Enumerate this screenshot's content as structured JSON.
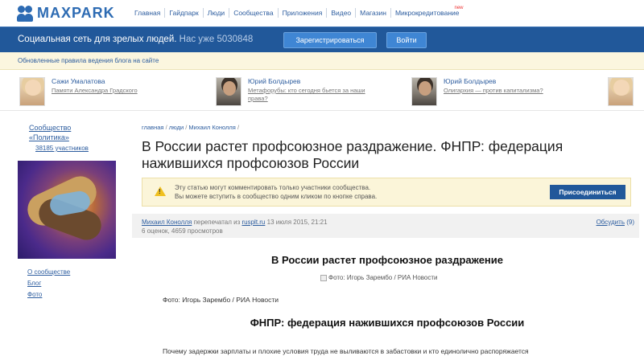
{
  "header": {
    "logo_text": "MAXPARK",
    "menu": [
      "Главная",
      "Гайдпарк",
      "Люди",
      "Сообщества",
      "Приложения",
      "Видео",
      "Магазин",
      "Микрокредитование"
    ],
    "new_badge": "new"
  },
  "bluebar": {
    "tagline": "Социальная сеть для зрелых людей.",
    "count": "Нас уже 5030848",
    "register_label": "Зарегистрироваться",
    "login_label": "Войти"
  },
  "notice_bar": {
    "text": "Обновленные правила ведения блога на сайте"
  },
  "blog_strip": [
    {
      "name": "Сажи Умалатова",
      "post": "Памяти Александра Градского",
      "avatar": "female"
    },
    {
      "name": "Юрий Болдырев",
      "post": "Метафорубы: кто сегодня бьется за наши права?",
      "avatar": "male"
    },
    {
      "name": "Юрий Болдырев",
      "post": "Олигархия — против капитализма?",
      "avatar": "male"
    },
    {
      "name": "",
      "post": "",
      "avatar": "female"
    }
  ],
  "sidebar": {
    "community_line1": "Сообщество",
    "community_line2": "«Политика»",
    "members": "38185 участников",
    "links": [
      "О сообществе",
      "Блог",
      "Фото"
    ]
  },
  "article": {
    "breadcrumb": [
      "главная",
      "люди",
      "Михаил Конолля"
    ],
    "title": "В России растет профсоюзное раздражение. ФНПР: федерация нажившихся профсоюзов России",
    "notice_line1": "Эту статью могут комментировать только участники сообщества.",
    "notice_line2": "Вы можете вступить в сообщество одним кликом по кнопке справа.",
    "join_label": "Присоединиться",
    "author": "Михаил Конолля",
    "reposted_from": "перепечатал из",
    "source": "rusplt.ru",
    "date": "13 июля 2015, 21:21",
    "stats": "6 оценок, 4659 просмотров",
    "discuss_label": "Обсудить",
    "discuss_count": "(9)",
    "heading1": "В России растет профсоюзное раздражение",
    "photo_alt": "Фото: Игорь Зарембо / РИА Новости",
    "photo_caption": "Фото: Игорь Зарембо / РИА Новости",
    "heading2": "ФНПР: федерация нажившихся профсоюзов России",
    "paragraph": "Почему задержки зарплаты и плохие условия труда не выливаются в забастовки и кто единолично распоряжается"
  }
}
